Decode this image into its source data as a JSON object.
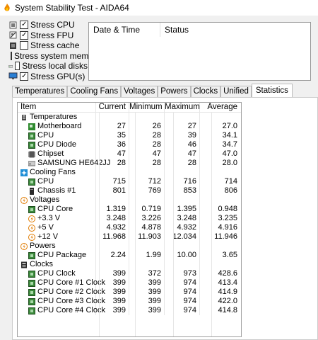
{
  "window": {
    "title": "System Stability Test - AIDA64"
  },
  "stress": [
    {
      "label": "Stress CPU",
      "checked": true,
      "icon": "cpu-chip-icon"
    },
    {
      "label": "Stress FPU",
      "checked": true,
      "icon": "fpu-chip-icon"
    },
    {
      "label": "Stress cache",
      "checked": false,
      "icon": "cache-chip-icon"
    },
    {
      "label": "Stress system memory",
      "checked": false,
      "icon": "memory-module-icon"
    },
    {
      "label": "Stress local disks",
      "checked": false,
      "icon": "disk-drive-icon"
    },
    {
      "label": "Stress GPU(s)",
      "checked": true,
      "icon": "monitor-icon"
    }
  ],
  "log": {
    "col_datetime": "Date & Time",
    "col_status": "Status"
  },
  "tabs": [
    "Temperatures",
    "Cooling Fans",
    "Voltages",
    "Powers",
    "Clocks",
    "Unified",
    "Statistics"
  ],
  "active_tab": "Statistics",
  "stats": {
    "headers": {
      "item": "Item",
      "current": "Current",
      "minimum": "Minimum",
      "maximum": "Maximum",
      "average": "Average"
    },
    "groups": [
      {
        "name": "Temperatures",
        "icon": "thermometer-icon",
        "rows": [
          {
            "item": "Motherboard",
            "icon": "motherboard-icon",
            "current": "27",
            "minimum": "26",
            "maximum": "27",
            "average": "27.0"
          },
          {
            "item": "CPU",
            "icon": "cpu-icon",
            "current": "35",
            "minimum": "28",
            "maximum": "39",
            "average": "34.1"
          },
          {
            "item": "CPU Diode",
            "icon": "cpu-icon",
            "current": "36",
            "minimum": "28",
            "maximum": "46",
            "average": "34.7"
          },
          {
            "item": "Chipset",
            "icon": "chipset-icon",
            "current": "47",
            "minimum": "47",
            "maximum": "47",
            "average": "47.0"
          },
          {
            "item": "SAMSUNG HE642JJ",
            "icon": "hdd-icon",
            "current": "28",
            "minimum": "28",
            "maximum": "28",
            "average": "28.0"
          }
        ]
      },
      {
        "name": "Cooling Fans",
        "icon": "fan-icon",
        "rows": [
          {
            "item": "CPU",
            "icon": "cpu-icon",
            "current": "715",
            "minimum": "712",
            "maximum": "716",
            "average": "714"
          },
          {
            "item": "Chassis #1",
            "icon": "chassis-icon",
            "current": "801",
            "minimum": "769",
            "maximum": "853",
            "average": "806"
          }
        ]
      },
      {
        "name": "Voltages",
        "icon": "voltage-icon",
        "rows": [
          {
            "item": "CPU Core",
            "icon": "cpu-icon",
            "current": "1.319",
            "minimum": "0.719",
            "maximum": "1.395",
            "average": "0.948"
          },
          {
            "item": "+3.3 V",
            "icon": "voltage-icon",
            "current": "3.248",
            "minimum": "3.226",
            "maximum": "3.248",
            "average": "3.235"
          },
          {
            "item": "+5 V",
            "icon": "voltage-icon",
            "current": "4.932",
            "minimum": "4.878",
            "maximum": "4.932",
            "average": "4.916"
          },
          {
            "item": "+12 V",
            "icon": "voltage-icon",
            "current": "11.968",
            "minimum": "11.903",
            "maximum": "12.034",
            "average": "11.946"
          }
        ]
      },
      {
        "name": "Powers",
        "icon": "power-icon",
        "rows": [
          {
            "item": "CPU Package",
            "icon": "cpu-icon",
            "current": "2.24",
            "minimum": "1.99",
            "maximum": "10.00",
            "average": "3.65"
          }
        ]
      },
      {
        "name": "Clocks",
        "icon": "clock-icon",
        "rows": [
          {
            "item": "CPU Clock",
            "icon": "cpu-icon",
            "current": "399",
            "minimum": "372",
            "maximum": "973",
            "average": "428.6"
          },
          {
            "item": "CPU Core #1 Clock",
            "icon": "cpu-icon",
            "current": "399",
            "minimum": "399",
            "maximum": "974",
            "average": "413.4"
          },
          {
            "item": "CPU Core #2 Clock",
            "icon": "cpu-icon",
            "current": "399",
            "minimum": "399",
            "maximum": "974",
            "average": "414.9"
          },
          {
            "item": "CPU Core #3 Clock",
            "icon": "cpu-icon",
            "current": "399",
            "minimum": "399",
            "maximum": "974",
            "average": "422.0"
          },
          {
            "item": "CPU Core #4 Clock",
            "icon": "cpu-icon",
            "current": "399",
            "minimum": "399",
            "maximum": "974",
            "average": "414.8"
          }
        ]
      }
    ]
  },
  "colors": {
    "accent_green": "#3a8a3a",
    "orange": "#e07b00",
    "fan_blue": "#1f8fd6"
  }
}
